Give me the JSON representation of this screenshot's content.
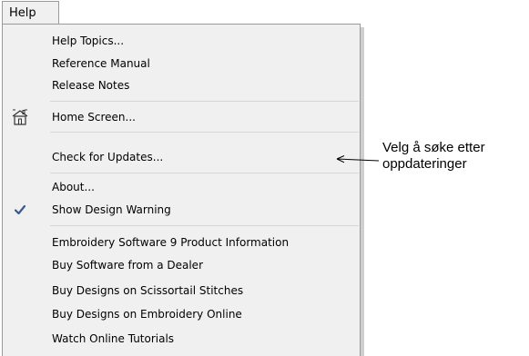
{
  "menu": {
    "title": "Help",
    "items": [
      {
        "label": "Help Topics...",
        "icon": null,
        "checked": false
      },
      {
        "label": "Reference Manual",
        "icon": null,
        "checked": false
      },
      {
        "label": "Release Notes",
        "icon": null,
        "checked": false
      },
      {
        "label": "Home Screen...",
        "icon": "home-screen-icon",
        "checked": false
      },
      {
        "label": "Check for Updates...",
        "icon": null,
        "checked": false
      },
      {
        "label": "About...",
        "icon": null,
        "checked": false
      },
      {
        "label": "Show Design Warning",
        "icon": "checkmark-icon",
        "checked": true
      },
      {
        "label": "Embroidery Software 9 Product Information",
        "icon": null,
        "checked": false
      },
      {
        "label": "Buy Software from a Dealer",
        "icon": null,
        "checked": false
      },
      {
        "label": "Buy Designs on Scissortail Stitches",
        "icon": null,
        "checked": false
      },
      {
        "label": "Buy Designs on Embroidery Online",
        "icon": null,
        "checked": false
      },
      {
        "label": "Watch Online Tutorials",
        "icon": null,
        "checked": false
      }
    ]
  },
  "annotation": {
    "line1": "Velg å søke etter",
    "line2": "oppdateringer"
  },
  "colors": {
    "menu_background": "#f0f0f0",
    "menu_border": "#9a9a9a",
    "separator": "#d7d7d7",
    "checkmark": "#3a5a8c"
  }
}
